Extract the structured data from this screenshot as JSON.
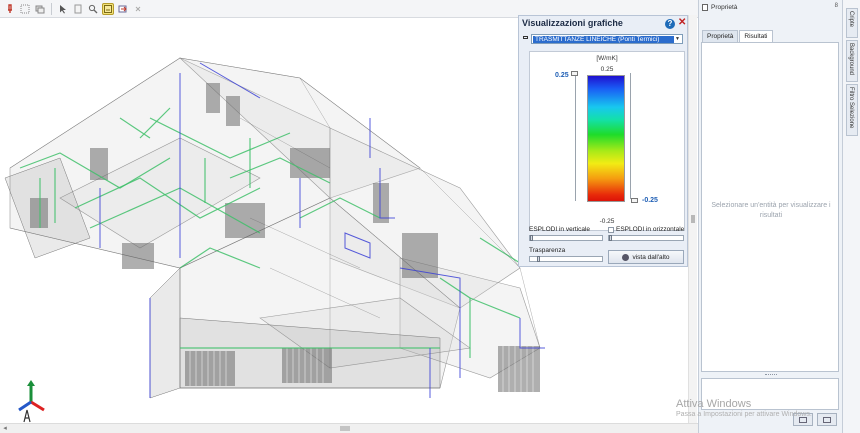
{
  "toolbar": {
    "icons": [
      "pin-icon",
      "grid-icon",
      "layers-icon",
      "cursor-icon",
      "page-icon",
      "zoom-icon",
      "render-icon",
      "export-icon",
      "close-small-icon"
    ]
  },
  "graphic_views": {
    "title": "Visualizzazioni grafiche",
    "selected_view": "TRASMITTANZE LINEICHE (Ponti Termici)",
    "legend": {
      "unit": "[W/mK]",
      "top_value": "0.25",
      "bottom_value": "-0.25",
      "max_handle_value": "0.25",
      "min_handle_value": "-0.25"
    },
    "explode_vertical_label": "ESPLODI in verticale",
    "explode_horizontal_label": "ESPLODI in orizzontale",
    "transparency_label": "Trasparenza",
    "top_view_button": "vista dall'alto"
  },
  "properties": {
    "title": "Proprietà",
    "pin": "8",
    "tabs": [
      "Proprietà",
      "Risultati"
    ],
    "selected_tab": "Risultati",
    "empty_message": "Selezionare un'entità per visualizzare i risultati"
  },
  "side_tabs": [
    "Cripte",
    "Background",
    "Filtro Selezione"
  ],
  "watermark": {
    "line1": "Attiva Windows",
    "line2": "Passa a Impostazioni per attivare Windows."
  },
  "colors": {
    "accent": "#2b6ccd",
    "legend_value": "#1f5fb5",
    "close": "#c02020"
  }
}
